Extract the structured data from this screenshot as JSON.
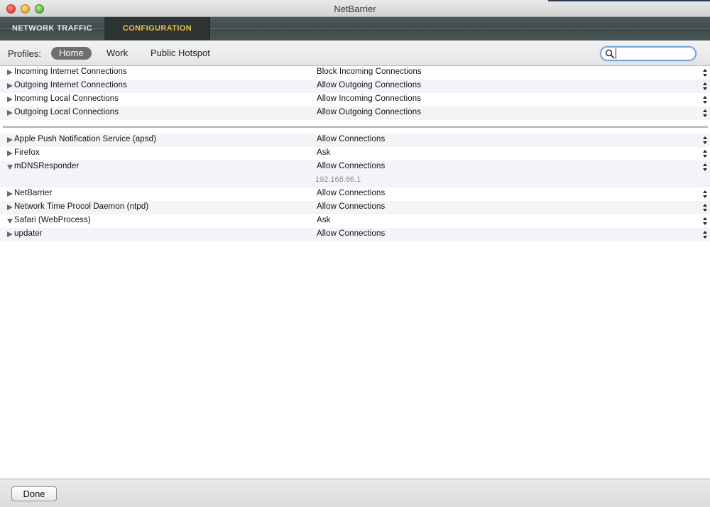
{
  "window": {
    "title": "NetBarrier"
  },
  "tabs": [
    {
      "label": "NETWORK TRAFFIC",
      "active": false
    },
    {
      "label": "CONFIGURATION",
      "active": true
    }
  ],
  "profiles": {
    "label": "Profiles:",
    "items": [
      {
        "label": "Home",
        "selected": true
      },
      {
        "label": "Work",
        "selected": false
      },
      {
        "label": "Public Hotspot",
        "selected": false
      }
    ]
  },
  "search": {
    "value": "",
    "placeholder": ""
  },
  "general_rules": [
    {
      "name": "Incoming Internet Connections",
      "action": "Block Incoming Connections"
    },
    {
      "name": "Outgoing Internet Connections",
      "action": "Allow Outgoing Connections"
    },
    {
      "name": "Incoming Local Connections",
      "action": "Allow Incoming Connections"
    },
    {
      "name": "Outgoing Local Connections",
      "action": "Allow Outgoing Connections"
    }
  ],
  "app_rules": [
    {
      "name": "Apple Push Notification Service (apsd)",
      "action": "Allow Connections",
      "expanded": false
    },
    {
      "name": "Firefox",
      "action": "Ask",
      "expanded": false
    },
    {
      "name": "mDNSResponder",
      "action": "Allow Connections",
      "expanded": true,
      "detail": "192.168.66.1"
    },
    {
      "name": "NetBarrier",
      "action": "Allow Connections",
      "expanded": false
    },
    {
      "name": "Network Time Procol Daemon (ntpd)",
      "action": "Allow Connections",
      "expanded": false
    },
    {
      "name": "Safari (WebProcess)",
      "action": "Ask",
      "expanded": true
    },
    {
      "name": "updater",
      "action": "Allow Connections",
      "expanded": false
    }
  ],
  "footer": {
    "done_label": "Done"
  },
  "colors": {
    "config_tab_text": "#f0c04a",
    "tabbar_bg": "#4a5656",
    "selected_profile_bg": "#6f6f6f",
    "search_focus_ring": "#7aa7d8"
  }
}
